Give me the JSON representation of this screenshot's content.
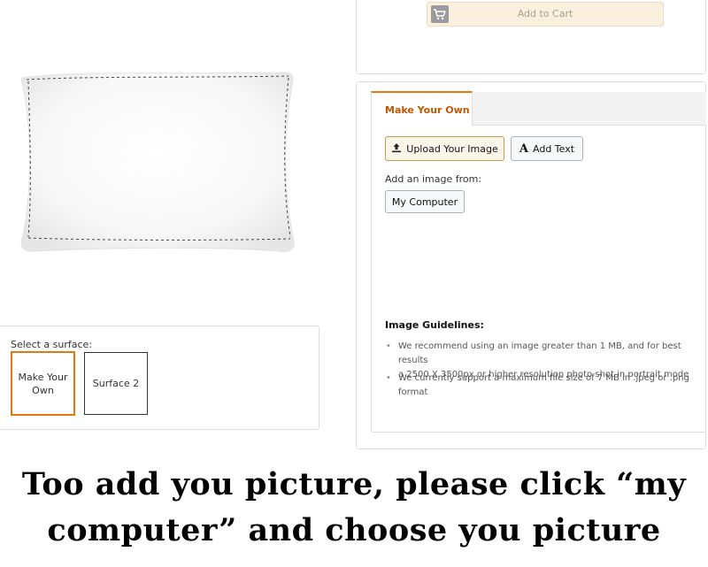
{
  "cart": {
    "add_to_cart_label": "Add to Cart",
    "icon": "cart-icon"
  },
  "product": {
    "image": "white-pillow"
  },
  "surface": {
    "label": "Select a surface:",
    "options": [
      {
        "label_line1": "Make Your",
        "label_line2": "Own",
        "selected": true
      },
      {
        "label_line1": "Surface 2",
        "label_line2": "",
        "selected": false
      }
    ]
  },
  "tabs": [
    {
      "label": "Make Your Own",
      "active": true
    }
  ],
  "toolbar": {
    "upload_label": "Upload Your Image",
    "upload_icon": "upload-icon",
    "add_text_label": "Add Text",
    "add_text_icon": "text-icon"
  },
  "image_source": {
    "label": "Add an image from:",
    "my_computer_label": "My Computer"
  },
  "guidelines": {
    "title": "Image Guidelines:",
    "items": [
      {
        "line1": "We recommend using an image greater than 1 MB, and for best results",
        "line2": "a 2500 X 3500px or higher resolution photo shot in portrait mode"
      },
      {
        "line1": "We currently support a maximum file size of 7 MB in .jpeg or .png",
        "line2": "format"
      }
    ]
  },
  "caption": {
    "line1": "Too add you picture, please click “my",
    "line2": "computer” and choose you picture"
  },
  "colors": {
    "accent": "#e47911",
    "tab_text": "#c45500",
    "cart_button_bg": "#fbf0dd"
  }
}
